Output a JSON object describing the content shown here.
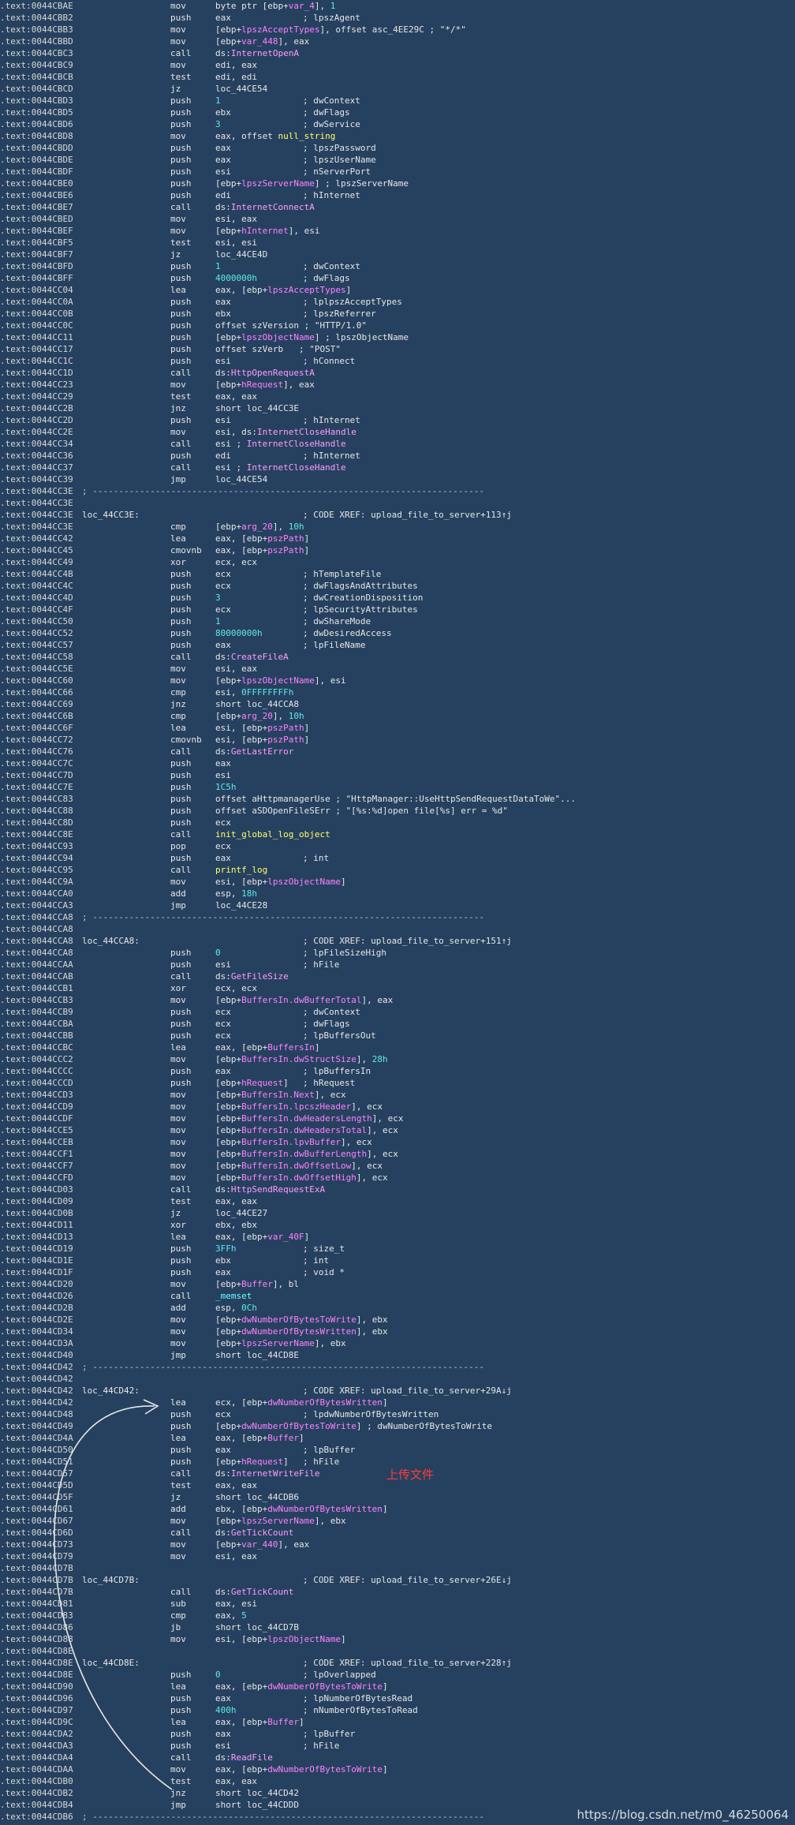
{
  "colors": {
    "background": "#26415f",
    "text": "#dcdcdc",
    "variable": "#ff80ff",
    "import": "#ff9cff",
    "number": "#5fe9e9",
    "function": "#ffff66",
    "annotation": "#ff3b3b"
  },
  "annotation": {
    "text": "上传文件"
  },
  "watermark": {
    "text": "https://blog.csdn.net/m0_46250064"
  },
  "lines": [
    {
      "a": ".text:0044CBAE",
      "m": "mov",
      "o": "byte ptr [ebp+var_4], 1",
      "c": ""
    },
    {
      "a": ".text:0044CBB2",
      "m": "push",
      "o": "eax",
      "c": "; lpszAgent"
    },
    {
      "a": ".text:0044CBB3",
      "m": "mov",
      "o": "[ebp+lpszAcceptTypes], offset asc_4EE29C ; \"*/*\"",
      "c": ""
    },
    {
      "a": ".text:0044CBBD",
      "m": "mov",
      "o": "[ebp+var_448], eax",
      "c": ""
    },
    {
      "a": ".text:0044CBC3",
      "m": "call",
      "o": "ds:InternetOpenA",
      "c": ""
    },
    {
      "a": ".text:0044CBC9",
      "m": "mov",
      "o": "edi, eax",
      "c": ""
    },
    {
      "a": ".text:0044CBCB",
      "m": "test",
      "o": "edi, edi",
      "c": ""
    },
    {
      "a": ".text:0044CBCD",
      "m": "jz",
      "o": "loc_44CE54",
      "c": ""
    },
    {
      "a": ".text:0044CBD3",
      "m": "push",
      "o": "1",
      "c": "; dwContext"
    },
    {
      "a": ".text:0044CBD5",
      "m": "push",
      "o": "ebx",
      "c": "; dwFlags"
    },
    {
      "a": ".text:0044CBD6",
      "m": "push",
      "o": "3",
      "c": "; dwService"
    },
    {
      "a": ".text:0044CBD8",
      "m": "mov",
      "o": "eax, offset null_string",
      "c": ""
    },
    {
      "a": ".text:0044CBDD",
      "m": "push",
      "o": "eax",
      "c": "; lpszPassword"
    },
    {
      "a": ".text:0044CBDE",
      "m": "push",
      "o": "eax",
      "c": "; lpszUserName"
    },
    {
      "a": ".text:0044CBDF",
      "m": "push",
      "o": "esi",
      "c": "; nServerPort"
    },
    {
      "a": ".text:0044CBE0",
      "m": "push",
      "o": "[ebp+lpszServerName] ; lpszServerName",
      "c": ""
    },
    {
      "a": ".text:0044CBE6",
      "m": "push",
      "o": "edi",
      "c": "; hInternet"
    },
    {
      "a": ".text:0044CBE7",
      "m": "call",
      "o": "ds:InternetConnectA",
      "c": ""
    },
    {
      "a": ".text:0044CBED",
      "m": "mov",
      "o": "esi, eax",
      "c": ""
    },
    {
      "a": ".text:0044CBEF",
      "m": "mov",
      "o": "[ebp+hInternet], esi",
      "c": ""
    },
    {
      "a": ".text:0044CBF5",
      "m": "test",
      "o": "esi, esi",
      "c": ""
    },
    {
      "a": ".text:0044CBF7",
      "m": "jz",
      "o": "loc_44CE4D",
      "c": ""
    },
    {
      "a": ".text:0044CBFD",
      "m": "push",
      "o": "1",
      "c": "; dwContext"
    },
    {
      "a": ".text:0044CBFF",
      "m": "push",
      "o": "4000000h",
      "c": "; dwFlags"
    },
    {
      "a": ".text:0044CC04",
      "m": "lea",
      "o": "eax, [ebp+lpszAcceptTypes]",
      "c": ""
    },
    {
      "a": ".text:0044CC0A",
      "m": "push",
      "o": "eax",
      "c": "; lplpszAcceptTypes"
    },
    {
      "a": ".text:0044CC0B",
      "m": "push",
      "o": "ebx",
      "c": "; lpszReferrer"
    },
    {
      "a": ".text:0044CC0C",
      "m": "push",
      "o": "offset szVersion ; \"HTTP/1.0\"",
      "c": ""
    },
    {
      "a": ".text:0044CC11",
      "m": "push",
      "o": "[ebp+lpszObjectName] ; lpszObjectName",
      "c": ""
    },
    {
      "a": ".text:0044CC17",
      "m": "push",
      "o": "offset szVerb   ; \"POST\"",
      "c": ""
    },
    {
      "a": ".text:0044CC1C",
      "m": "push",
      "o": "esi",
      "c": "; hConnect"
    },
    {
      "a": ".text:0044CC1D",
      "m": "call",
      "o": "ds:HttpOpenRequestA",
      "c": ""
    },
    {
      "a": ".text:0044CC23",
      "m": "mov",
      "o": "[ebp+hRequest], eax",
      "c": ""
    },
    {
      "a": ".text:0044CC29",
      "m": "test",
      "o": "eax, eax",
      "c": ""
    },
    {
      "a": ".text:0044CC2B",
      "m": "jnz",
      "o": "short loc_44CC3E",
      "c": ""
    },
    {
      "a": ".text:0044CC2D",
      "m": "push",
      "o": "esi",
      "c": "; hInternet"
    },
    {
      "a": ".text:0044CC2E",
      "m": "mov",
      "o": "esi, ds:InternetCloseHandle",
      "c": ""
    },
    {
      "a": ".text:0044CC34",
      "m": "call",
      "o": "esi ; InternetCloseHandle",
      "c": ""
    },
    {
      "a": ".text:0044CC36",
      "m": "push",
      "o": "edi",
      "c": "; hInternet"
    },
    {
      "a": ".text:0044CC37",
      "m": "call",
      "o": "esi ; InternetCloseHandle",
      "c": ""
    },
    {
      "a": ".text:0044CC39",
      "m": "jmp",
      "o": "loc_44CE54",
      "c": ""
    },
    {
      "a": ".text:0044CC3E",
      "sep": "; ---------------------------------------------------------------------------"
    },
    {
      "a": ".text:0044CC3E"
    },
    {
      "a": ".text:0044CC3E",
      "l": "loc_44CC3E:",
      "c": "; CODE XREF: upload_file_to_server+113↑j"
    },
    {
      "a": ".text:0044CC3E",
      "m": "cmp",
      "o": "[ebp+arg_20], 10h",
      "c": ""
    },
    {
      "a": ".text:0044CC42",
      "m": "lea",
      "o": "eax, [ebp+pszPath]",
      "c": ""
    },
    {
      "a": ".text:0044CC45",
      "m": "cmovnb",
      "o": "eax, [ebp+pszPath]",
      "c": ""
    },
    {
      "a": ".text:0044CC49",
      "m": "xor",
      "o": "ecx, ecx",
      "c": ""
    },
    {
      "a": ".text:0044CC4B",
      "m": "push",
      "o": "ecx",
      "c": "; hTemplateFile"
    },
    {
      "a": ".text:0044CC4C",
      "m": "push",
      "o": "ecx",
      "c": "; dwFlagsAndAttributes"
    },
    {
      "a": ".text:0044CC4D",
      "m": "push",
      "o": "3",
      "c": "; dwCreationDisposition"
    },
    {
      "a": ".text:0044CC4F",
      "m": "push",
      "o": "ecx",
      "c": "; lpSecurityAttributes"
    },
    {
      "a": ".text:0044CC50",
      "m": "push",
      "o": "1",
      "c": "; dwShareMode"
    },
    {
      "a": ".text:0044CC52",
      "m": "push",
      "o": "80000000h",
      "c": "; dwDesiredAccess"
    },
    {
      "a": ".text:0044CC57",
      "m": "push",
      "o": "eax",
      "c": "; lpFileName"
    },
    {
      "a": ".text:0044CC58",
      "m": "call",
      "o": "ds:CreateFileA",
      "c": ""
    },
    {
      "a": ".text:0044CC5E",
      "m": "mov",
      "o": "esi, eax",
      "c": ""
    },
    {
      "a": ".text:0044CC60",
      "m": "mov",
      "o": "[ebp+lpszObjectName], esi",
      "c": ""
    },
    {
      "a": ".text:0044CC66",
      "m": "cmp",
      "o": "esi, 0FFFFFFFFh",
      "c": ""
    },
    {
      "a": ".text:0044CC69",
      "m": "jnz",
      "o": "short loc_44CCA8",
      "c": ""
    },
    {
      "a": ".text:0044CC6B",
      "m": "cmp",
      "o": "[ebp+arg_20], 10h",
      "c": ""
    },
    {
      "a": ".text:0044CC6F",
      "m": "lea",
      "o": "esi, [ebp+pszPath]",
      "c": ""
    },
    {
      "a": ".text:0044CC72",
      "m": "cmovnb",
      "o": "esi, [ebp+pszPath]",
      "c": ""
    },
    {
      "a": ".text:0044CC76",
      "m": "call",
      "o": "ds:GetLastError",
      "c": ""
    },
    {
      "a": ".text:0044CC7C",
      "m": "push",
      "o": "eax",
      "c": ""
    },
    {
      "a": ".text:0044CC7D",
      "m": "push",
      "o": "esi",
      "c": ""
    },
    {
      "a": ".text:0044CC7E",
      "m": "push",
      "o": "1C5h",
      "c": ""
    },
    {
      "a": ".text:0044CC83",
      "m": "push",
      "o": "offset aHttpmanagerUse ; \"HttpManager::UseHttpSendRequestDataToWe\"...",
      "c": ""
    },
    {
      "a": ".text:0044CC88",
      "m": "push",
      "o": "offset aSDOpenFileSErr ; \"[%s:%d]open file[%s] err = %d\"",
      "c": ""
    },
    {
      "a": ".text:0044CC8D",
      "m": "push",
      "o": "ecx",
      "c": ""
    },
    {
      "a": ".text:0044CC8E",
      "m": "call",
      "o": "init_global_log_object",
      "c": ""
    },
    {
      "a": ".text:0044CC93",
      "m": "pop",
      "o": "ecx",
      "c": ""
    },
    {
      "a": ".text:0044CC94",
      "m": "push",
      "o": "eax",
      "c": "; int"
    },
    {
      "a": ".text:0044CC95",
      "m": "call",
      "o": "printf_log",
      "c": ""
    },
    {
      "a": ".text:0044CC9A",
      "m": "mov",
      "o": "esi, [ebp+lpszObjectName]",
      "c": ""
    },
    {
      "a": ".text:0044CCA0",
      "m": "add",
      "o": "esp, 18h",
      "c": ""
    },
    {
      "a": ".text:0044CCA3",
      "m": "jmp",
      "o": "loc_44CE28",
      "c": ""
    },
    {
      "a": ".text:0044CCA8",
      "sep": "; ---------------------------------------------------------------------------"
    },
    {
      "a": ".text:0044CCA8"
    },
    {
      "a": ".text:0044CCA8",
      "l": "loc_44CCA8:",
      "c": "; CODE XREF: upload_file_to_server+151↑j"
    },
    {
      "a": ".text:0044CCA8",
      "m": "push",
      "o": "0",
      "c": "; lpFileSizeHigh"
    },
    {
      "a": ".text:0044CCAA",
      "m": "push",
      "o": "esi",
      "c": "; hFile"
    },
    {
      "a": ".text:0044CCAB",
      "m": "call",
      "o": "ds:GetFileSize",
      "c": ""
    },
    {
      "a": ".text:0044CCB1",
      "m": "xor",
      "o": "ecx, ecx",
      "c": ""
    },
    {
      "a": ".text:0044CCB3",
      "m": "mov",
      "o": "[ebp+BuffersIn.dwBufferTotal], eax",
      "c": ""
    },
    {
      "a": ".text:0044CCB9",
      "m": "push",
      "o": "ecx",
      "c": "; dwContext"
    },
    {
      "a": ".text:0044CCBA",
      "m": "push",
      "o": "ecx",
      "c": "; dwFlags"
    },
    {
      "a": ".text:0044CCBB",
      "m": "push",
      "o": "ecx",
      "c": "; lpBuffersOut"
    },
    {
      "a": ".text:0044CCBC",
      "m": "lea",
      "o": "eax, [ebp+BuffersIn]",
      "c": ""
    },
    {
      "a": ".text:0044CCC2",
      "m": "mov",
      "o": "[ebp+BuffersIn.dwStructSize], 28h",
      "c": ""
    },
    {
      "a": ".text:0044CCCC",
      "m": "push",
      "o": "eax",
      "c": "; lpBuffersIn"
    },
    {
      "a": ".text:0044CCCD",
      "m": "push",
      "o": "[ebp+hRequest]",
      "c": "; hRequest"
    },
    {
      "a": ".text:0044CCD3",
      "m": "mov",
      "o": "[ebp+BuffersIn.Next], ecx",
      "c": ""
    },
    {
      "a": ".text:0044CCD9",
      "m": "mov",
      "o": "[ebp+BuffersIn.lpcszHeader], ecx",
      "c": ""
    },
    {
      "a": ".text:0044CCDF",
      "m": "mov",
      "o": "[ebp+BuffersIn.dwHeadersLength], ecx",
      "c": ""
    },
    {
      "a": ".text:0044CCE5",
      "m": "mov",
      "o": "[ebp+BuffersIn.dwHeadersTotal], ecx",
      "c": ""
    },
    {
      "a": ".text:0044CCEB",
      "m": "mov",
      "o": "[ebp+BuffersIn.lpvBuffer], ecx",
      "c": ""
    },
    {
      "a": ".text:0044CCF1",
      "m": "mov",
      "o": "[ebp+BuffersIn.dwBufferLength], ecx",
      "c": ""
    },
    {
      "a": ".text:0044CCF7",
      "m": "mov",
      "o": "[ebp+BuffersIn.dwOffsetLow], ecx",
      "c": ""
    },
    {
      "a": ".text:0044CCFD",
      "m": "mov",
      "o": "[ebp+BuffersIn.dwOffsetHigh], ecx",
      "c": ""
    },
    {
      "a": ".text:0044CD03",
      "m": "call",
      "o": "ds:HttpSendRequestExA",
      "c": ""
    },
    {
      "a": ".text:0044CD09",
      "m": "test",
      "o": "eax, eax",
      "c": ""
    },
    {
      "a": ".text:0044CD0B",
      "m": "jz",
      "o": "loc_44CE27",
      "c": ""
    },
    {
      "a": ".text:0044CD11",
      "m": "xor",
      "o": "ebx, ebx",
      "c": ""
    },
    {
      "a": ".text:0044CD13",
      "m": "lea",
      "o": "eax, [ebp+var_40F]",
      "c": ""
    },
    {
      "a": ".text:0044CD19",
      "m": "push",
      "o": "3FFh",
      "c": "; size_t"
    },
    {
      "a": ".text:0044CD1E",
      "m": "push",
      "o": "ebx",
      "c": "; int"
    },
    {
      "a": ".text:0044CD1F",
      "m": "push",
      "o": "eax",
      "c": "; void *"
    },
    {
      "a": ".text:0044CD20",
      "m": "mov",
      "o": "[ebp+Buffer], bl",
      "c": ""
    },
    {
      "a": ".text:0044CD26",
      "m": "call",
      "o": "_memset",
      "c": ""
    },
    {
      "a": ".text:0044CD2B",
      "m": "add",
      "o": "esp, 0Ch",
      "c": ""
    },
    {
      "a": ".text:0044CD2E",
      "m": "mov",
      "o": "[ebp+dwNumberOfBytesToWrite], ebx",
      "c": ""
    },
    {
      "a": ".text:0044CD34",
      "m": "mov",
      "o": "[ebp+dwNumberOfBytesWritten], ebx",
      "c": ""
    },
    {
      "a": ".text:0044CD3A",
      "m": "mov",
      "o": "[ebp+lpszServerName], ebx",
      "c": ""
    },
    {
      "a": ".text:0044CD40",
      "m": "jmp",
      "o": "short loc_44CD8E",
      "c": ""
    },
    {
      "a": ".text:0044CD42",
      "sep": "; ---------------------------------------------------------------------------"
    },
    {
      "a": ".text:0044CD42"
    },
    {
      "a": ".text:0044CD42",
      "l": "loc_44CD42:",
      "c": "; CODE XREF: upload_file_to_server+29A↓j"
    },
    {
      "a": ".text:0044CD42",
      "m": "lea",
      "o": "ecx, [ebp+dwNumberOfBytesWritten]",
      "c": ""
    },
    {
      "a": ".text:0044CD48",
      "m": "push",
      "o": "ecx",
      "c": "; lpdwNumberOfBytesWritten"
    },
    {
      "a": ".text:0044CD49",
      "m": "push",
      "o": "[ebp+dwNumberOfBytesToWrite] ; dwNumberOfBytesToWrite",
      "c": ""
    },
    {
      "a": ".text:0044CD4A",
      "m": "lea",
      "o": "eax, [ebp+Buffer]",
      "c": ""
    },
    {
      "a": ".text:0044CD50",
      "m": "push",
      "o": "eax",
      "c": "; lpBuffer"
    },
    {
      "a": ".text:0044CD51",
      "m": "push",
      "o": "[ebp+hRequest]",
      "c": "; hFile"
    },
    {
      "a": ".text:0044CD57",
      "m": "call",
      "o": "ds:InternetWriteFile",
      "c": ""
    },
    {
      "a": ".text:0044CD5D",
      "m": "test",
      "o": "eax, eax",
      "c": ""
    },
    {
      "a": ".text:0044CD5F",
      "m": "jz",
      "o": "short loc_44CDB6",
      "c": ""
    },
    {
      "a": ".text:0044CD61",
      "m": "add",
      "o": "ebx, [ebp+dwNumberOfBytesWritten]",
      "c": ""
    },
    {
      "a": ".text:0044CD67",
      "m": "mov",
      "o": "[ebp+lpszServerName], ebx",
      "c": ""
    },
    {
      "a": ".text:0044CD6D",
      "m": "call",
      "o": "ds:GetTickCount",
      "c": ""
    },
    {
      "a": ".text:0044CD73",
      "m": "mov",
      "o": "[ebp+var_440], eax",
      "c": ""
    },
    {
      "a": ".text:0044CD79",
      "m": "mov",
      "o": "esi, eax",
      "c": ""
    },
    {
      "a": ".text:0044CD7B"
    },
    {
      "a": ".text:0044CD7B",
      "l": "loc_44CD7B:",
      "c": "; CODE XREF: upload_file_to_server+26E↓j"
    },
    {
      "a": ".text:0044CD7B",
      "m": "call",
      "o": "ds:GetTickCount",
      "c": ""
    },
    {
      "a": ".text:0044CD81",
      "m": "sub",
      "o": "eax, esi",
      "c": ""
    },
    {
      "a": ".text:0044CD83",
      "m": "cmp",
      "o": "eax, 5",
      "c": ""
    },
    {
      "a": ".text:0044CD86",
      "m": "jb",
      "o": "short loc_44CD7B",
      "c": ""
    },
    {
      "a": ".text:0044CD88",
      "m": "mov",
      "o": "esi, [ebp+lpszObjectName]",
      "c": ""
    },
    {
      "a": ".text:0044CD8E"
    },
    {
      "a": ".text:0044CD8E",
      "l": "loc_44CD8E:",
      "c": "; CODE XREF: upload_file_to_server+228↑j"
    },
    {
      "a": ".text:0044CD8E",
      "m": "push",
      "o": "0",
      "c": "; lpOverlapped"
    },
    {
      "a": ".text:0044CD90",
      "m": "lea",
      "o": "eax, [ebp+dwNumberOfBytesToWrite]",
      "c": ""
    },
    {
      "a": ".text:0044CD96",
      "m": "push",
      "o": "eax",
      "c": "; lpNumberOfBytesRead"
    },
    {
      "a": ".text:0044CD97",
      "m": "push",
      "o": "400h",
      "c": "; nNumberOfBytesToRead"
    },
    {
      "a": ".text:0044CD9C",
      "m": "lea",
      "o": "eax, [ebp+Buffer]",
      "c": ""
    },
    {
      "a": ".text:0044CDA2",
      "m": "push",
      "o": "eax",
      "c": "; lpBuffer"
    },
    {
      "a": ".text:0044CDA3",
      "m": "push",
      "o": "esi",
      "c": "; hFile"
    },
    {
      "a": ".text:0044CDA4",
      "m": "call",
      "o": "ds:ReadFile",
      "c": ""
    },
    {
      "a": ".text:0044CDAA",
      "m": "mov",
      "o": "eax, [ebp+dwNumberOfBytesToWrite]",
      "c": ""
    },
    {
      "a": ".text:0044CDB0",
      "m": "test",
      "o": "eax, eax",
      "c": ""
    },
    {
      "a": ".text:0044CDB2",
      "m": "jnz",
      "o": "short loc_44CD42",
      "c": ""
    },
    {
      "a": ".text:0044CDB4",
      "m": "jmp",
      "o": "short loc_44CDDD",
      "c": ""
    },
    {
      "a": ".text:0044CDB6",
      "sep": "; ---------------------------------------------------------------------------"
    }
  ]
}
